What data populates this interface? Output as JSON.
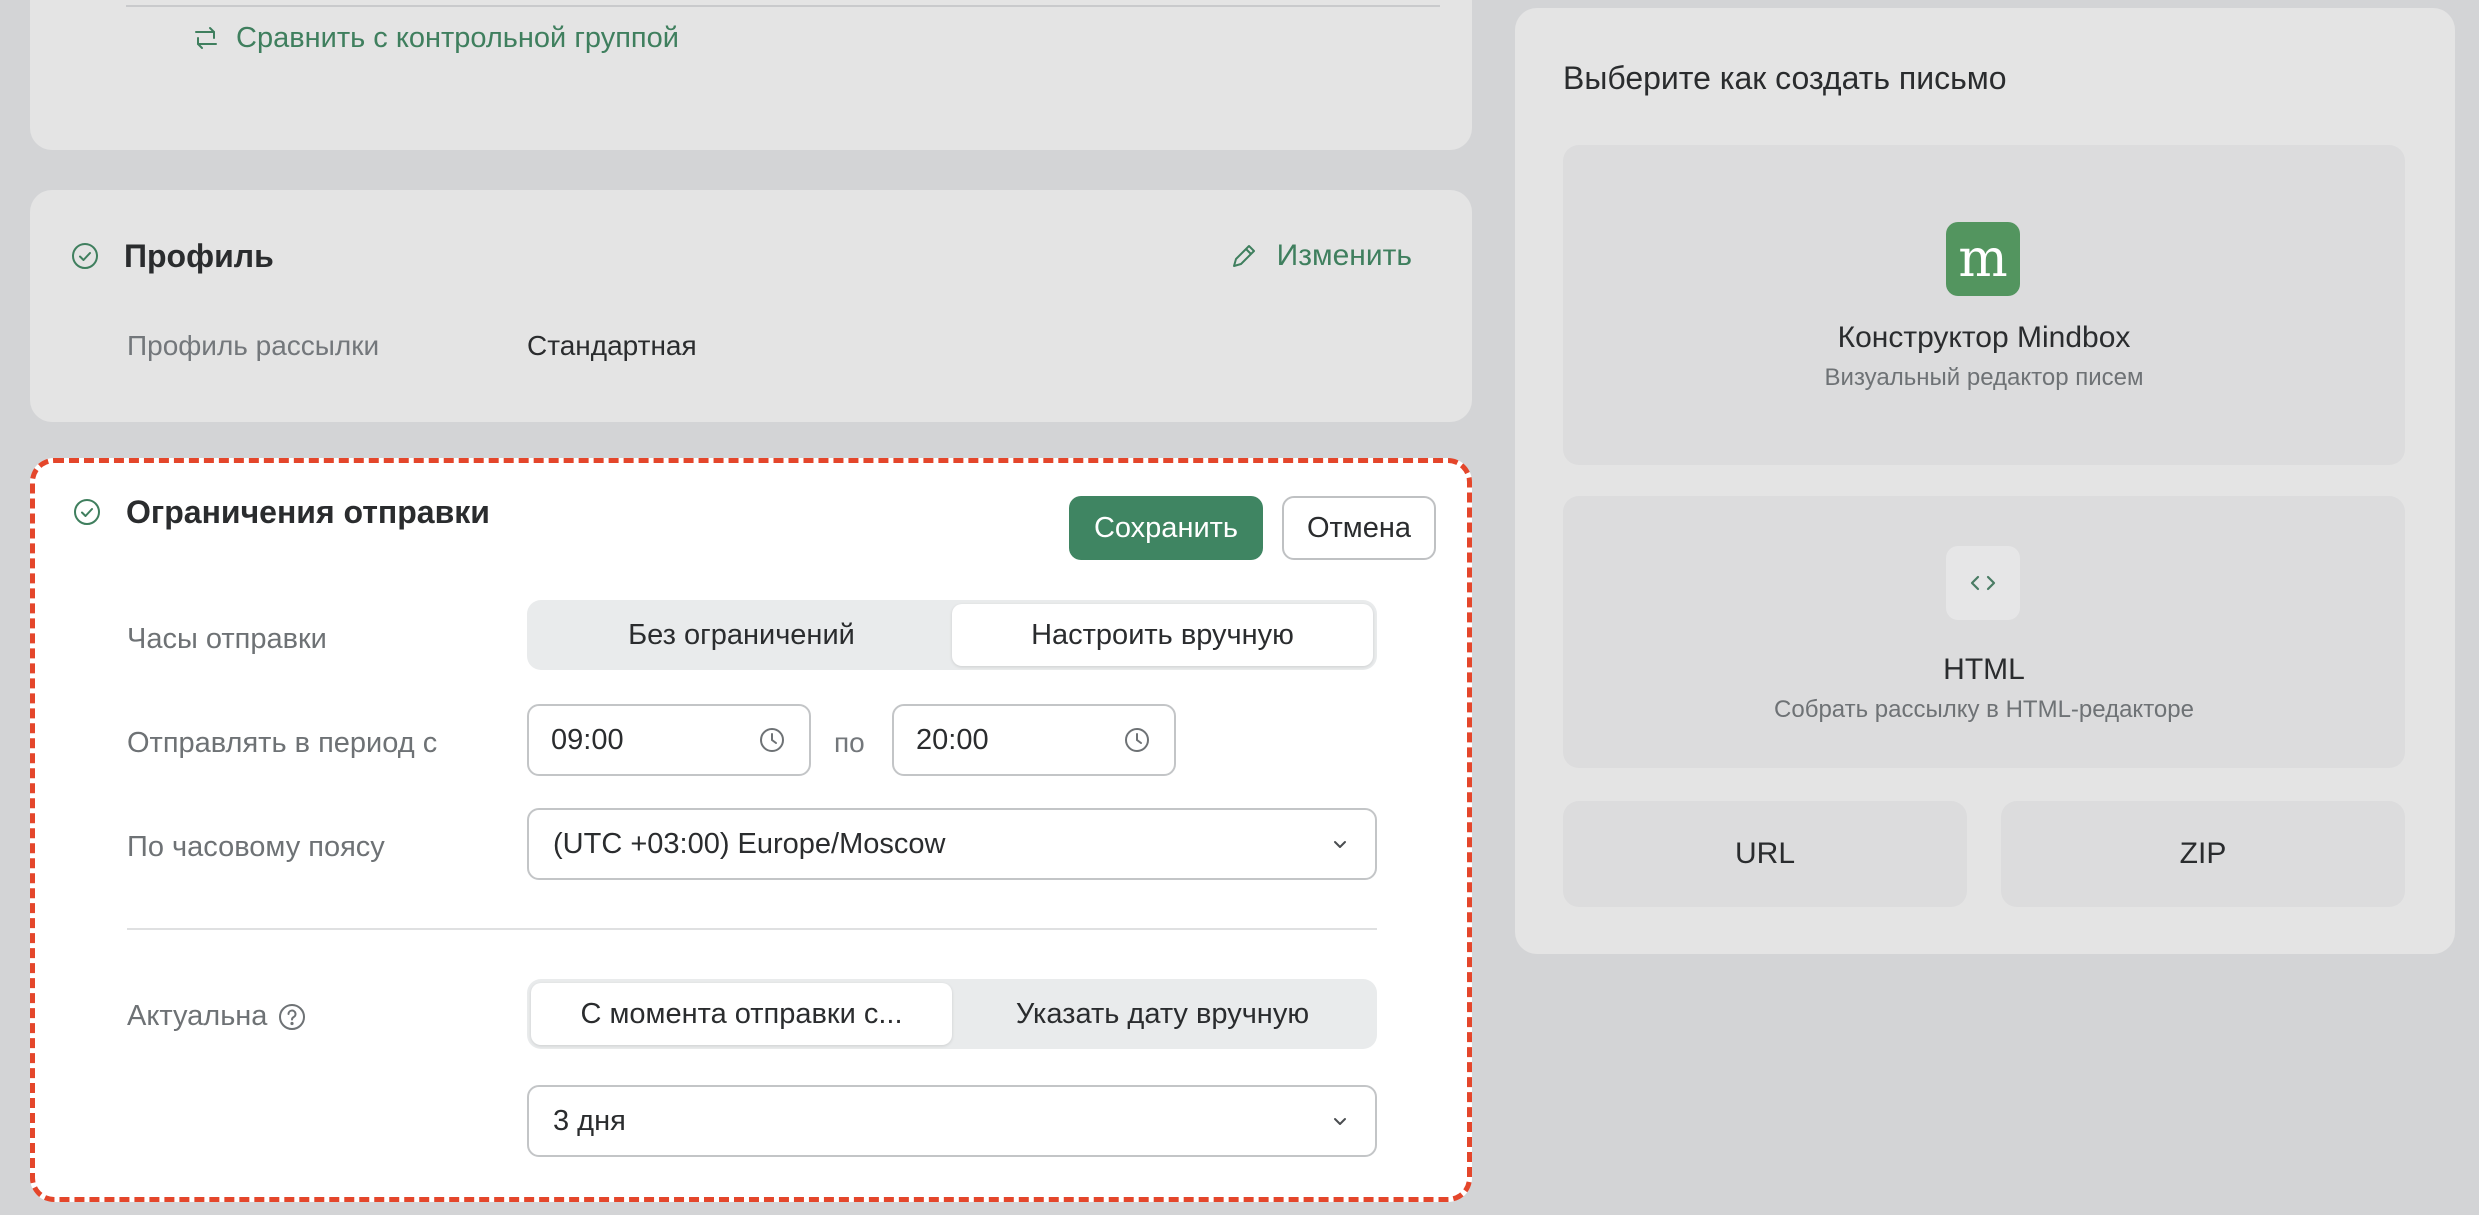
{
  "compare": {
    "link_label": "Сравнить с контрольной группой"
  },
  "profile": {
    "title": "Профиль",
    "edit_label": "Изменить",
    "field_label": "Профиль рассылки",
    "field_value": "Стандартная"
  },
  "restrictions": {
    "title": "Ограничения отправки",
    "save_label": "Сохранить",
    "cancel_label": "Отмена",
    "hours": {
      "label": "Часы отправки",
      "options": [
        "Без ограничений",
        "Настроить вручную"
      ],
      "selected": "Настроить вручную"
    },
    "period": {
      "label": "Отправлять в период с",
      "from": "09:00",
      "separator": "по",
      "to": "20:00"
    },
    "timezone": {
      "label": "По часовому поясу",
      "value": "(UTC +03:00) Europe/Moscow"
    },
    "actual": {
      "label": "Актуальна",
      "options": [
        "С момента отправки с...",
        "Указать дату вручную"
      ],
      "selected": "С момента отправки с...",
      "duration": "3 дня"
    }
  },
  "create": {
    "title": "Выберите как создать письмо",
    "mindbox": {
      "logo_letter": "m",
      "title": "Конструктор Mindbox",
      "subtitle": "Визуальный редактор писем"
    },
    "html": {
      "title": "HTML",
      "subtitle": "Собрать рассылку в HTML-редакторе"
    },
    "url_label": "URL",
    "zip_label": "ZIP"
  },
  "colors": {
    "accent_green": "#3f8562",
    "link_green": "#3f7f5e",
    "highlight_red": "#e4462b",
    "logo_green": "#53955f"
  },
  "icons": [
    "compare-icon",
    "check-circle-icon",
    "pencil-icon",
    "clock-icon",
    "chevron-down-icon",
    "help-icon",
    "code-icon"
  ]
}
